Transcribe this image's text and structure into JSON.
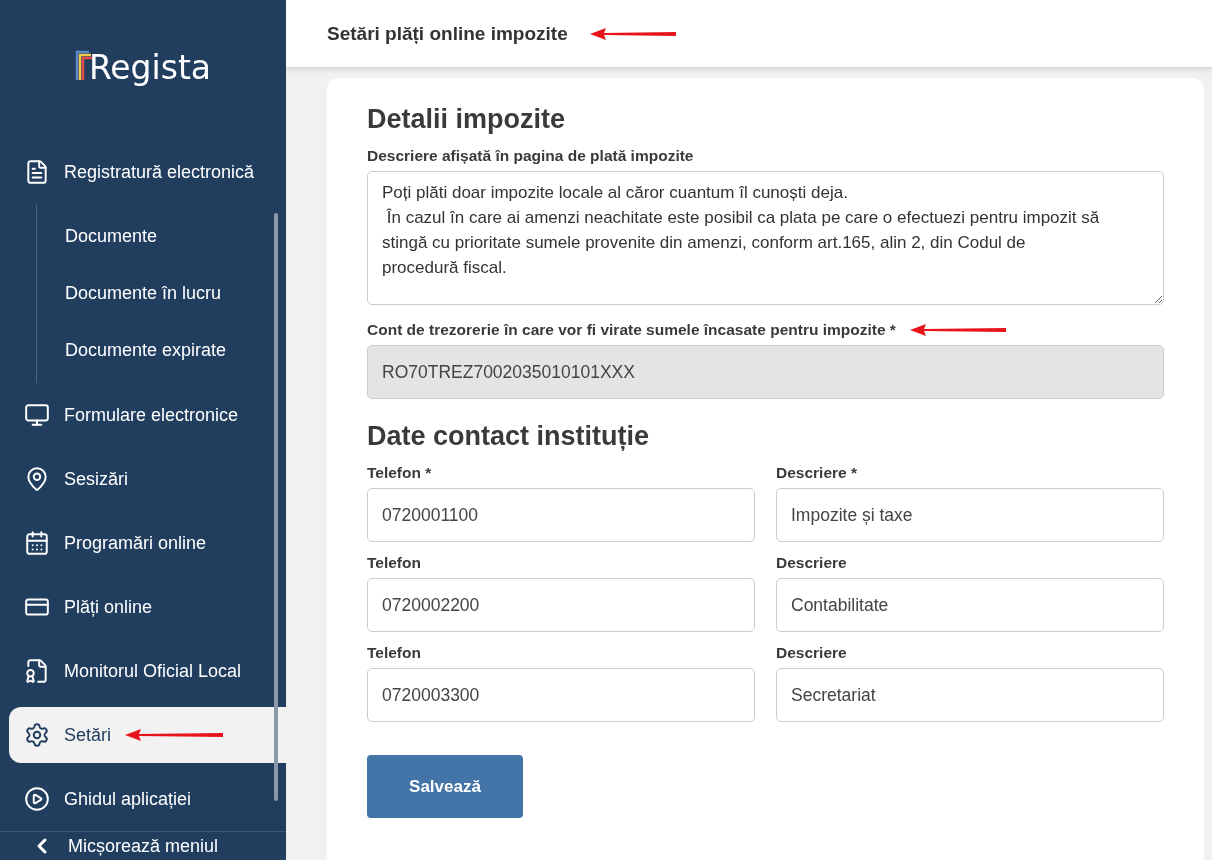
{
  "logo": {
    "text": "Regista"
  },
  "sidebar": {
    "items": [
      {
        "label": "Registratură electronică",
        "selected": false,
        "children": [
          {
            "label": "Documente",
            "selected": false
          },
          {
            "label": "Documente în lucru",
            "selected": false
          },
          {
            "label": "Documente expirate",
            "selected": false
          }
        ]
      },
      {
        "label": "Formulare electronice",
        "selected": false
      },
      {
        "label": "Sesizări",
        "selected": false
      },
      {
        "label": "Programări online",
        "selected": false
      },
      {
        "label": "Plăți online",
        "selected": false
      },
      {
        "label": "Monitorul Oficial Local",
        "selected": false
      },
      {
        "label": "Setări",
        "selected": true
      },
      {
        "label": "Ghidul aplicației",
        "selected": false
      }
    ],
    "collapse": {
      "label": "Micșorează meniul"
    }
  },
  "header": {
    "title": "Setări plăți online impozite"
  },
  "details": {
    "heading": "Detalii impozite",
    "description_label": "Descriere afișată în pagina de plată impozite",
    "description_value": "Poți plăti doar impozite locale al căror cuantum îl cunoști deja.\n În cazul în care ai amenzi neachitate este posibil ca plata pe care o efectuezi pentru impozit să stingă cu prioritate sumele provenite din amenzi, conform art.165, alin 2, din Codul de procedură fiscal.",
    "account_label": "Cont de trezorerie în care vor fi virate sumele încasate pentru impozite *",
    "account_value": "RO70TREZ7002035010101XXX",
    "account_disabled": true
  },
  "contact": {
    "heading": "Date contact instituție",
    "rows": [
      {
        "phone_label": "Telefon *",
        "phone": "0720001100",
        "description_label": "Descriere *",
        "description": "Impozite și taxe"
      },
      {
        "phone_label": "Telefon",
        "phone": "0720002200",
        "description_label": "Descriere",
        "description": "Contabilitate"
      },
      {
        "phone_label": "Telefon",
        "phone": "0720003300",
        "description_label": "Descriere",
        "description": "Secretariat"
      }
    ]
  },
  "save_button": {
    "label": "Salvează"
  }
}
